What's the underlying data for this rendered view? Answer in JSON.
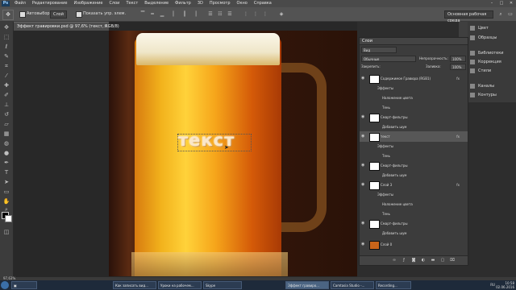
{
  "menu": {
    "logo": "Ps",
    "items": [
      "Файл",
      "Редактирование",
      "Изображение",
      "Слои",
      "Текст",
      "Выделение",
      "Фильтр",
      "3D",
      "Просмотр",
      "Окно",
      "Справка"
    ],
    "window_buttons": [
      "–",
      "□",
      "✕"
    ]
  },
  "options_bar": {
    "tool_icon": "move-tool-icon",
    "auto_select_label": "Автовыбор:",
    "auto_select_value": "Слой",
    "show_transform_label": "Показать упр. элем.",
    "workspace": "Основная рабочая среда"
  },
  "document": {
    "tab_title": "Эффект гравировки.psd @ 97,6% (текст, RGB/8)",
    "close": "×",
    "canvas_text": "текст"
  },
  "status_bar": {
    "zoom": "97,63%"
  },
  "right_dock": {
    "items": [
      {
        "label": "Цвет",
        "icon": "color-icon"
      },
      {
        "label": "Образцы",
        "icon": "swatches-icon"
      },
      {
        "label": "Библиотеки",
        "icon": "libraries-icon"
      },
      {
        "label": "Коррекция",
        "icon": "adjustments-icon"
      },
      {
        "label": "Стили",
        "icon": "styles-icon"
      },
      {
        "label": "Каналы",
        "icon": "channels-icon"
      },
      {
        "label": "Контуры",
        "icon": "paths-icon"
      }
    ]
  },
  "layers_panel": {
    "title": "Слои",
    "filter_label": "Вид",
    "blend_mode": "Обычные",
    "opacity_label": "Непрозрачность:",
    "opacity_value": "100%",
    "lock_label": "Закрепить:",
    "fill_label": "Заливка:",
    "fill_value": "100%",
    "rows": [
      {
        "name": "Содержимое Гравюра (RGB1)",
        "type": "layer",
        "fx": "fx"
      },
      {
        "name": "Эффекты",
        "type": "sub"
      },
      {
        "name": "Наложение цвета",
        "type": "sub2"
      },
      {
        "name": "Тень",
        "type": "sub2"
      },
      {
        "name": "Смарт-фильтры",
        "type": "layer",
        "fx": ""
      },
      {
        "name": "Добавить шум",
        "type": "sub2"
      },
      {
        "name": "текст",
        "type": "layer",
        "fx": "fx",
        "selected": true
      },
      {
        "name": "Эффекты",
        "type": "sub"
      },
      {
        "name": "Тень",
        "type": "sub2"
      },
      {
        "name": "Смарт-фильтры",
        "type": "layer",
        "fx": ""
      },
      {
        "name": "Добавить шум",
        "type": "sub2"
      },
      {
        "name": "Слой 3",
        "type": "layer",
        "fx": "fx"
      },
      {
        "name": "Эффекты",
        "type": "sub"
      },
      {
        "name": "Наложение цвета",
        "type": "sub2"
      },
      {
        "name": "Тень",
        "type": "sub2"
      },
      {
        "name": "Смарт-фильтры",
        "type": "layer",
        "fx": ""
      },
      {
        "name": "Добавить шум",
        "type": "sub2"
      },
      {
        "name": "Слой 0",
        "type": "layer",
        "fx": ""
      }
    ]
  },
  "taskbar": {
    "buttons": [
      "Как записать вид...",
      "Уроки на рабочем...",
      "Skype",
      "Эффект гравиро...",
      "Camtasia Studio -...",
      "Recording..."
    ],
    "lang": "RU",
    "time": "10:58",
    "date": "02.06.2016"
  }
}
